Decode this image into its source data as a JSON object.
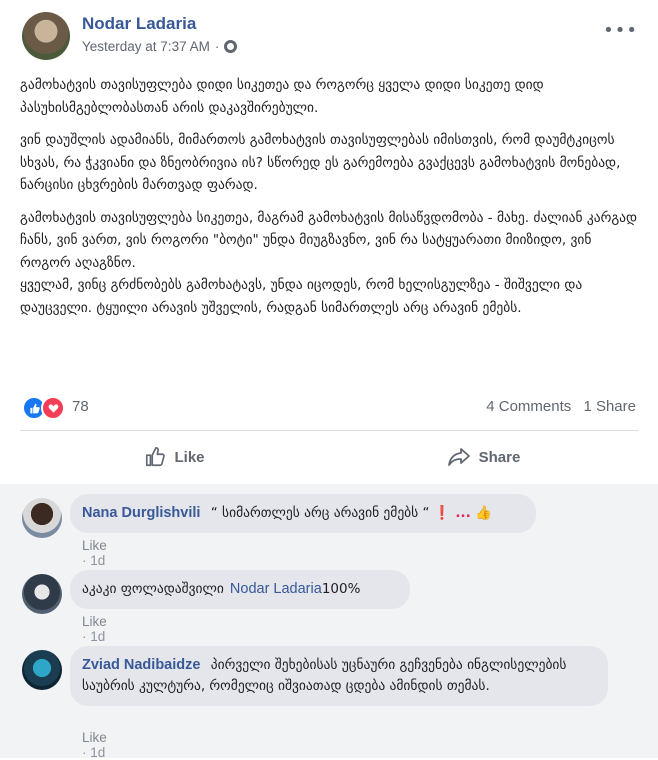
{
  "post": {
    "author": "Nodar Ladaria",
    "timestamp": "Yesterday at 7:37 AM",
    "separator": "·",
    "privacy_icon": "globe-icon",
    "more_label": "•••",
    "paragraphs": [
      "გამოხატვის თავისუფლება დიდი სიკეთეა და როგორც ყველა დიდი სიკეთე დიდ პასუხისმგებლობასთან არის დაკავშირებული.",
      "ვინ დაუშლის ადამიანს, მიმართოს გამოხატვის თავისუფლებას იმისთვის, რომ დაუმტკიცოს სხვას, რა ჭკვიანი და ზნეობრივია ის? სწორედ ეს გარემოება გვაქცევს გამოხატვის მონებად, ნარცისი ცხვრების მართვად ფარად.",
      "გამოხატვის თავისუფლება სიკეთეა, მაგრამ გამოხატვის მისაწვდომობა - მახე. ძალიან კარგად ჩანს, ვინ ვართ, ვის როგორი \"ბოტი\" უნდა მიუგზავნო, ვინ რა სატყუარათი მიიზიდო, ვინ როგორ აღაგზნო.\nყველამ, ვინც გრძნობებს გამოხატავს, უნდა იცოდეს, რომ ხელისგულზეა - შიშველი და დაუცველი. ტყუილი არავის უშველის, რადგან სიმართლეს არც არავინ ემებს."
    ]
  },
  "reactions": {
    "count": "78",
    "comments": "4 Comments",
    "shares": "1 Share",
    "colors": {
      "like": "#1877f2",
      "love": "#f33e58"
    }
  },
  "actions": {
    "like_label": "Like",
    "share_label": "Share"
  },
  "comments": [
    {
      "name": "Nana Durglishvili",
      "text": "“ სიმართლეს არც არავინ ემებს “",
      "extra": "❗ ... 👍",
      "like_label": "Like",
      "sep": "·",
      "time": "1d"
    },
    {
      "name": "აკაკი ფოლადაშვილი",
      "mention": "Nodar Ladaria",
      "text": "100%",
      "like_label": "Like",
      "sep": "·",
      "time": "1d"
    },
    {
      "name": "Zviad Nadibaidze",
      "text": "პირველი შეხებისას უცნაური გეჩვენება ინგლისელების საუბრის კულტურა, რომელიც იშვიათად ცდება ამინდის თემას.",
      "like_label": "Like",
      "sep": "·",
      "time": "1d"
    }
  ]
}
